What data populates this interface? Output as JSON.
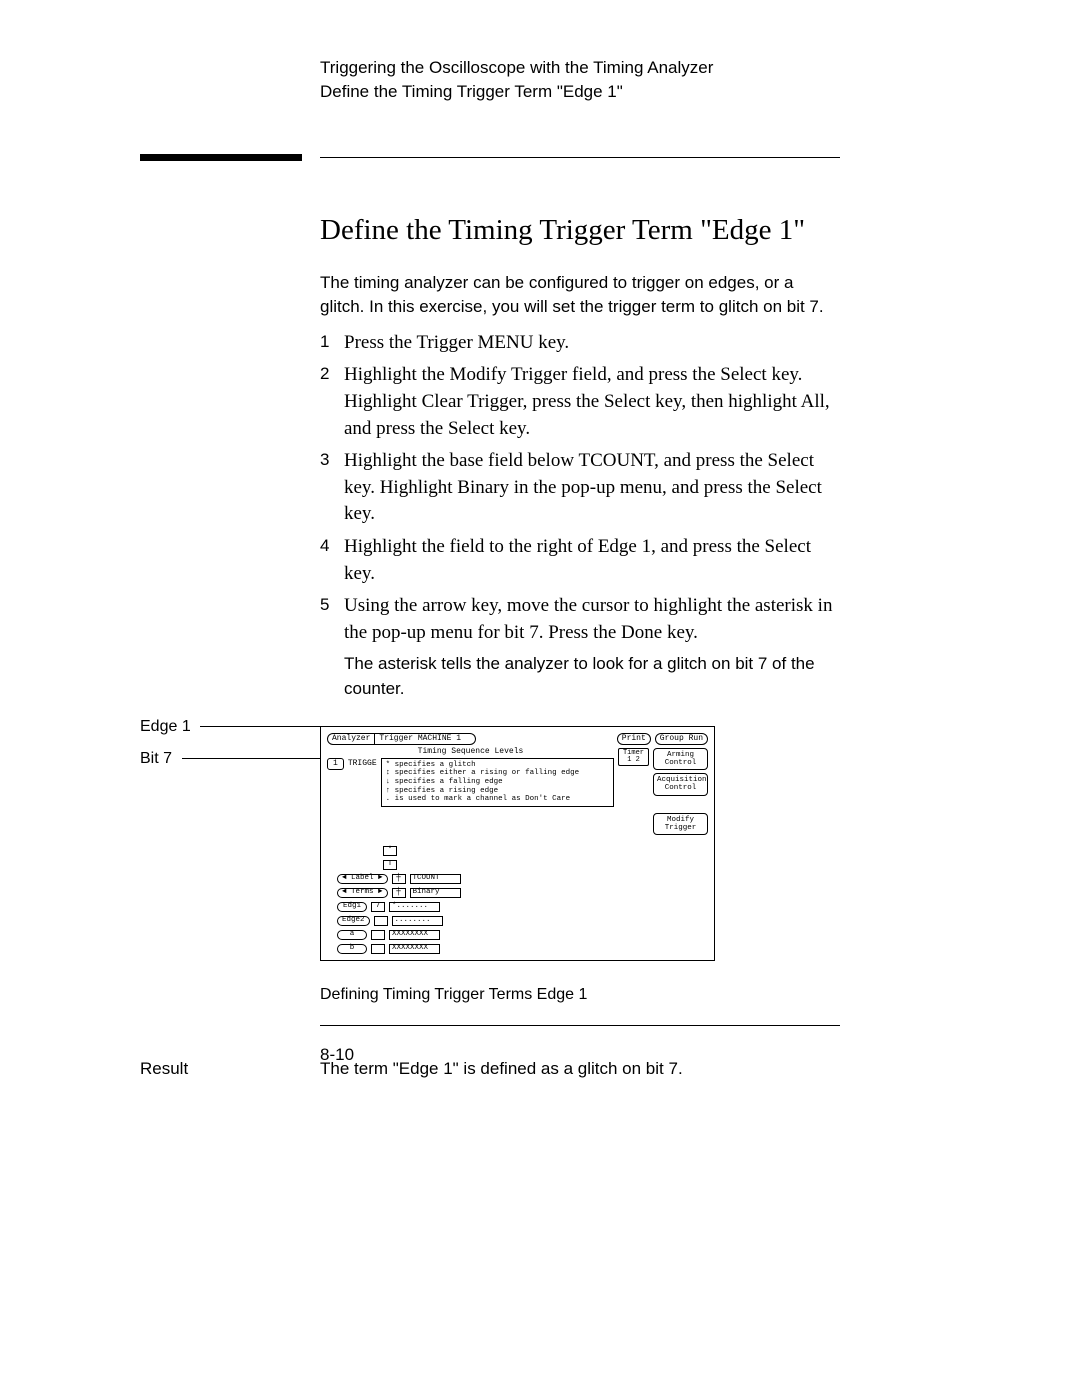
{
  "running_header": {
    "line1": "Triggering the Oscilloscope with the Timing Analyzer",
    "line2": "Define the Timing Trigger Term \"Edge 1\""
  },
  "section_title": "Define the Timing Trigger Term \"Edge 1\"",
  "intro": "The timing analyzer can be configured to trigger on edges, or a glitch.  In this exercise, you will set the trigger term to glitch on bit 7.",
  "steps": [
    "Press the Trigger MENU key.",
    "Highlight the Modify Trigger field, and press the Select key.  Highlight Clear Trigger, press the Select key, then highlight All, and press the Select key.",
    "Highlight the base field below TCOUNT, and press the Select key. Highlight Binary in the pop-up menu, and press the Select key.",
    "Highlight the field to the right of Edge 1, and press the Select key.",
    "Using the arrow key, move the cursor to highlight the asterisk in the pop-up menu for bit 7.  Press the Done key."
  ],
  "note": "The asterisk tells the analyzer to look for a glitch on bit 7 of the counter.",
  "figure": {
    "top_left": [
      "Analyzer",
      "Trigger   MACHINE 1"
    ],
    "top_right": [
      "Print",
      "Group Run"
    ],
    "seq_title": "Timing Sequence Levels",
    "timer": "Timer\n1 2",
    "right_buttons": [
      "Arming\nControl",
      "Acquisition\nControl",
      "Modify\nTrigger"
    ],
    "seq_num": "1",
    "seq_label": "TRIGGE",
    "spec_lines": [
      "* specifies a glitch",
      "↕ specifies either a rising or falling edge",
      "↓ specifies a falling edge",
      "↑ specifies a rising edge",
      ". is used to mark a channel as Don't Care"
    ],
    "col_star": "*",
    "col_t": "T",
    "rows": {
      "label_btn": "◄ Label ►",
      "terms_btn": "◄ Terms ►",
      "label_col": "TCOUNT",
      "terms_col": "Binary",
      "edg1": {
        "name": "Edg1",
        "bit": "7",
        "val": "*......."
      },
      "edge2": {
        "name": "Edge2",
        "val": "........"
      },
      "a": {
        "name": "a",
        "val": "XXXXXXXX"
      },
      "b": {
        "name": "b",
        "val": "XXXXXXXX"
      }
    }
  },
  "figure_caption": "Defining Timing Trigger Terms Edge 1",
  "side_tags": {
    "edge1": "Edge 1",
    "bit7": "Bit 7"
  },
  "result": {
    "label": "Result",
    "text": "The term \"Edge 1\" is defined as a glitch on bit 7."
  },
  "page_number": "8-10"
}
